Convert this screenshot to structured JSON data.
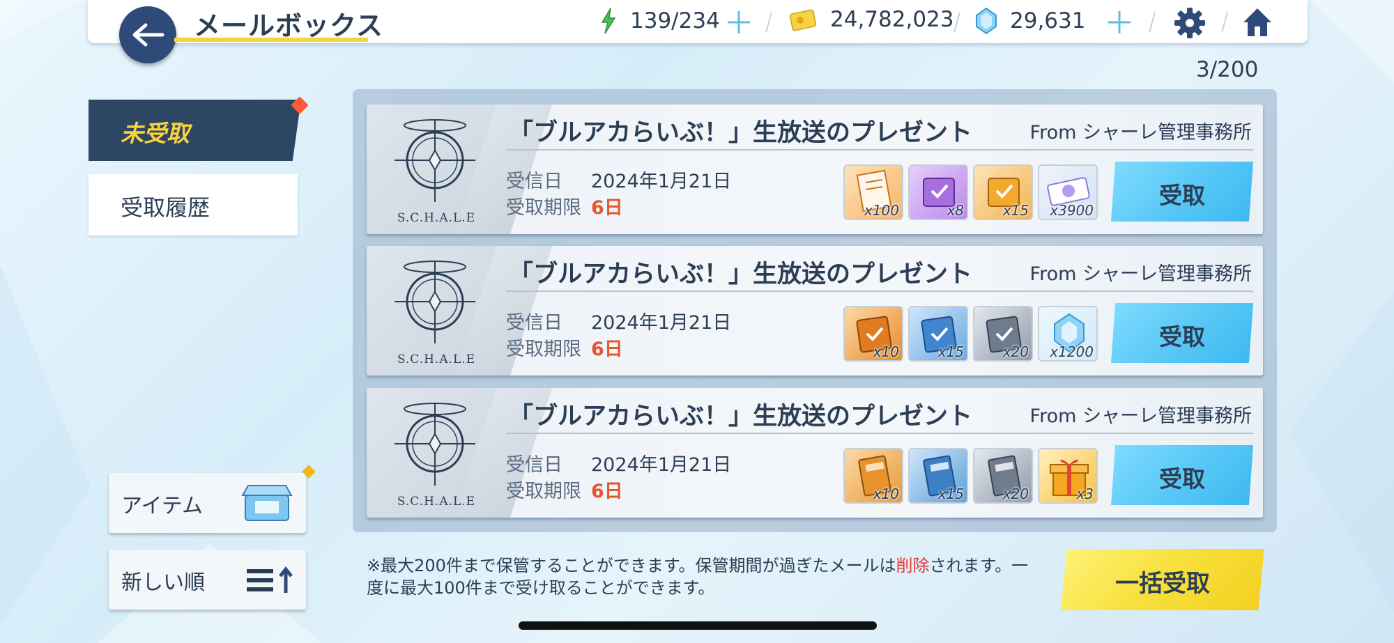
{
  "header": {
    "title": "メールボックス",
    "ap": "139/234",
    "credits": "24,782,023",
    "gems": "29,631"
  },
  "mail_count": "3/200",
  "tabs": {
    "unreceived": "未受取",
    "history": "受取履歴"
  },
  "side_buttons": {
    "item": "アイテム",
    "sort": "新しい順"
  },
  "labels": {
    "received_date": "受信日",
    "deadline": "受取期限",
    "receive": "受取",
    "logo_text": "S.C.H.A.L.E"
  },
  "mails": [
    {
      "subject": "「ブルアカらいぶ！」生放送のプレゼント",
      "from": "From シャーレ管理事務所",
      "date": "2024年1月21日",
      "deadline": "6日",
      "items": [
        {
          "icon": "report-item-icon",
          "qty": "x100"
        },
        {
          "icon": "purple-box-icon",
          "qty": "x8"
        },
        {
          "icon": "orange-box-icon",
          "qty": "x15"
        },
        {
          "icon": "ticket-icon",
          "qty": "x3900"
        }
      ]
    },
    {
      "subject": "「ブルアカらいぶ！」生放送のプレゼント",
      "from": "From シャーレ管理事務所",
      "date": "2024年1月21日",
      "deadline": "6日",
      "items": [
        {
          "icon": "orange-ex-item-icon",
          "qty": "x10"
        },
        {
          "icon": "blue-ex-item-icon",
          "qty": "x15"
        },
        {
          "icon": "gray-ex-item-icon",
          "qty": "x20"
        },
        {
          "icon": "gem-icon",
          "qty": "x1200"
        }
      ]
    },
    {
      "subject": "「ブルアカらいぶ！」生放送のプレゼント",
      "from": "From シャーレ管理事務所",
      "date": "2024年1月21日",
      "deadline": "6日",
      "items": [
        {
          "icon": "orange-book-icon",
          "qty": "x10"
        },
        {
          "icon": "blue-book-icon",
          "qty": "x15"
        },
        {
          "icon": "gray-book-icon",
          "qty": "x20"
        },
        {
          "icon": "gift-box-icon",
          "qty": "x3"
        }
      ]
    }
  ],
  "note": {
    "part1": "※最大200件まで保管することができます。保管期間が過ぎたメールは",
    "del": "削除",
    "part2": "されます。一度に最大100件まで受け取ることができます。"
  },
  "bulk_receive": "一括受取",
  "colors": {
    "navy": "#2c4664",
    "accent_yellow": "#f8d33b",
    "receive_blue": "#56c7f6",
    "deadline_red": "#e4572e"
  }
}
